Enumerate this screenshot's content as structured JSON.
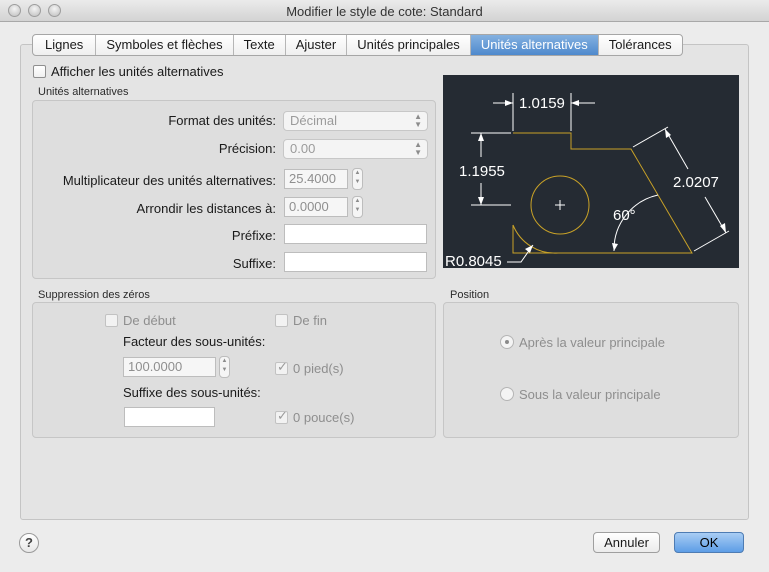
{
  "window": {
    "title": "Modifier le style de cote: Standard"
  },
  "tabs": [
    {
      "label": "Lignes",
      "active": false
    },
    {
      "label": "Symboles et flèches",
      "active": false
    },
    {
      "label": "Texte",
      "active": false
    },
    {
      "label": "Ajuster",
      "active": false
    },
    {
      "label": "Unités principales",
      "active": false
    },
    {
      "label": "Unités alternatives",
      "active": true
    },
    {
      "label": "Tolérances",
      "active": false
    }
  ],
  "show_alt_units": {
    "label": "Afficher les unités alternatives",
    "checked": false
  },
  "alt_units": {
    "title": "Unités alternatives",
    "format_label": "Format des unités:",
    "format_value": "Décimal",
    "precision_label": "Précision:",
    "precision_value": "0.00",
    "multiplier_label": "Multiplicateur des unités alternatives:",
    "multiplier_value": "25.4000",
    "round_label": "Arrondir les distances à:",
    "round_value": "0.0000",
    "prefix_label": "Préfixe:",
    "prefix_value": "",
    "suffix_label": "Suffixe:",
    "suffix_value": ""
  },
  "zero_suppression": {
    "title": "Suppression des zéros",
    "leading_label": "De début",
    "trailing_label": "De fin",
    "subunit_factor_label": "Facteur des sous-unités:",
    "subunit_factor_value": "100.0000",
    "feet_label": "0 pied(s)",
    "subunit_suffix_label": "Suffixe des sous-unités:",
    "subunit_suffix_value": "",
    "inches_label": "0 pouce(s)"
  },
  "position": {
    "title": "Position",
    "after_label": "Après la valeur principale",
    "below_label": "Sous la valeur principale",
    "selected": "after"
  },
  "preview": {
    "dim_top": "1.0159",
    "dim_left": "1.1955",
    "dim_right": "2.0207",
    "angle": "60°",
    "radius": "R0.8045",
    "colors": {
      "background": "#252b33",
      "geometry": "#c9a227",
      "dimension": "#ffffff"
    }
  },
  "buttons": {
    "cancel": "Annuler",
    "ok": "OK",
    "help": "?"
  }
}
